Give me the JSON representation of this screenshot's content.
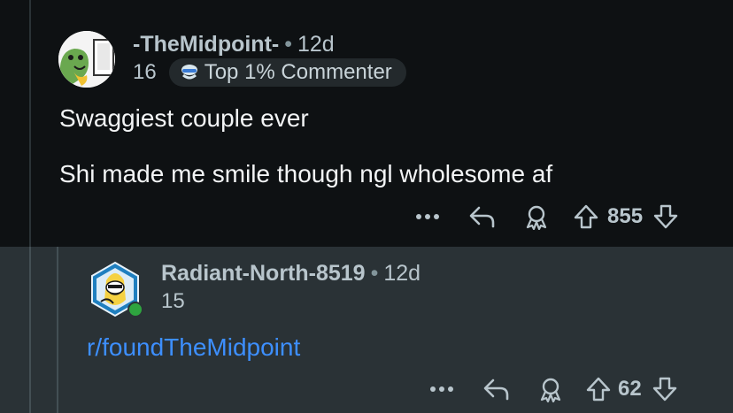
{
  "comment1": {
    "username": "-TheMidpoint-",
    "separator": "•",
    "age": "12d",
    "score_top": "16",
    "flair": "Top 1% Commenter",
    "body": [
      "Swaggiest couple ever",
      "Shi made me smile though ngl wholesome af"
    ],
    "vote_count": "855",
    "icons": [
      "more-icon",
      "reply-icon",
      "award-icon",
      "upvote-icon",
      "downvote-icon"
    ]
  },
  "comment2": {
    "username": "Radiant-North-8519",
    "separator": "•",
    "age": "12d",
    "score_top": "15",
    "link": "r/foundTheMidpoint",
    "vote_count": "62",
    "online_color": "#2ea43f"
  },
  "colors": {
    "background": "#0e1113",
    "reply_background": "#2a3236",
    "link": "#3d8fff",
    "meta_text": "#b8c5cc"
  }
}
